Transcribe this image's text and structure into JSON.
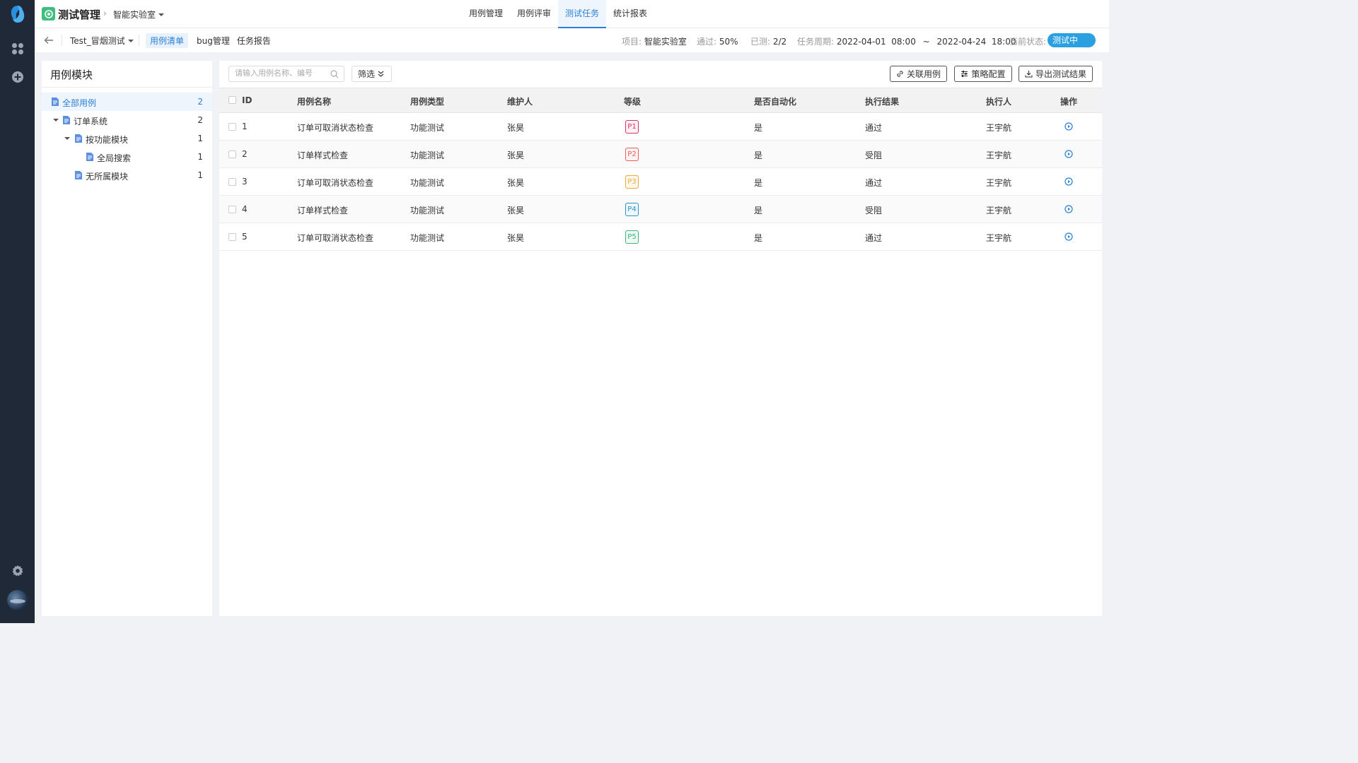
{
  "header": {
    "app_title": "测试管理",
    "project": "智能实验室",
    "tabs": [
      {
        "label": "用例管理",
        "active": false
      },
      {
        "label": "用例评审",
        "active": false
      },
      {
        "label": "测试任务",
        "active": true
      },
      {
        "label": "统计报表",
        "active": false
      }
    ]
  },
  "subheader": {
    "task_name": "Test_冒烟测试",
    "tabs": [
      {
        "label": "用例清单",
        "active": true
      },
      {
        "label": "bug管理",
        "active": false
      },
      {
        "label": "任务报告",
        "active": false
      }
    ],
    "project_key": "项目:",
    "project_val": "智能实验室",
    "pass_key": "通过:",
    "pass_val": "50%",
    "tested_key": "已测:",
    "tested_val": "2/2",
    "period_key": "任务周期:",
    "period_start": "2022-04-01  08:00",
    "period_tilde": "~",
    "period_end": "2022-04-24  18:00",
    "status_key": "当前状态:",
    "status_val": "测试中"
  },
  "left_panel": {
    "title": "用例模块",
    "tree": [
      {
        "label": "全部用例",
        "count": "2",
        "level": 0,
        "active": true
      },
      {
        "label": "订单系统",
        "count": "2",
        "level": 1,
        "expanded": true
      },
      {
        "label": "按功能模块",
        "count": "1",
        "level": 2,
        "expanded": true
      },
      {
        "label": "全局搜索",
        "count": "1",
        "level": 3
      },
      {
        "label": "无所属模块",
        "count": "1",
        "level": 2
      }
    ]
  },
  "toolbar": {
    "search_placeholder": "请输入用例名称、编号",
    "filter_label": "筛选",
    "link_case_label": "关联用例",
    "strategy_label": "策略配置",
    "export_label": "导出测试结果"
  },
  "table": {
    "headers": {
      "id": "ID",
      "name": "用例名称",
      "type": "用例类型",
      "maintainer": "维护人",
      "level": "等级",
      "auto": "是否自动化",
      "result": "执行结果",
      "executor": "执行人",
      "op": "操作"
    },
    "rows": [
      {
        "id": "1",
        "name": "订单可取消状态检查",
        "type": "功能测试",
        "maintainer": "张昊",
        "level": "P1",
        "auto": "是",
        "result": "通过",
        "executor": "王宇航"
      },
      {
        "id": "2",
        "name": "订单样式检查",
        "type": "功能测试",
        "maintainer": "张昊",
        "level": "P2",
        "auto": "是",
        "result": "受阻",
        "executor": "王宇航"
      },
      {
        "id": "3",
        "name": "订单可取消状态检查",
        "type": "功能测试",
        "maintainer": "张昊",
        "level": "P3",
        "auto": "是",
        "result": "通过",
        "executor": "王宇航"
      },
      {
        "id": "4",
        "name": "订单样式检查",
        "type": "功能测试",
        "maintainer": "张昊",
        "level": "P4",
        "auto": "是",
        "result": "受阻",
        "executor": "王宇航"
      },
      {
        "id": "5",
        "name": "订单可取消状态检查",
        "type": "功能测试",
        "maintainer": "张昊",
        "level": "P5",
        "auto": "是",
        "result": "通过",
        "executor": "王宇航"
      }
    ]
  },
  "colors": {
    "accent": "#2b7fd6",
    "status_pill": "#2aa0e0",
    "P1": "#d6336c",
    "P2": "#e8615a",
    "P3": "#f0a93b",
    "P4": "#2b93c9",
    "P5": "#3fb37f"
  }
}
